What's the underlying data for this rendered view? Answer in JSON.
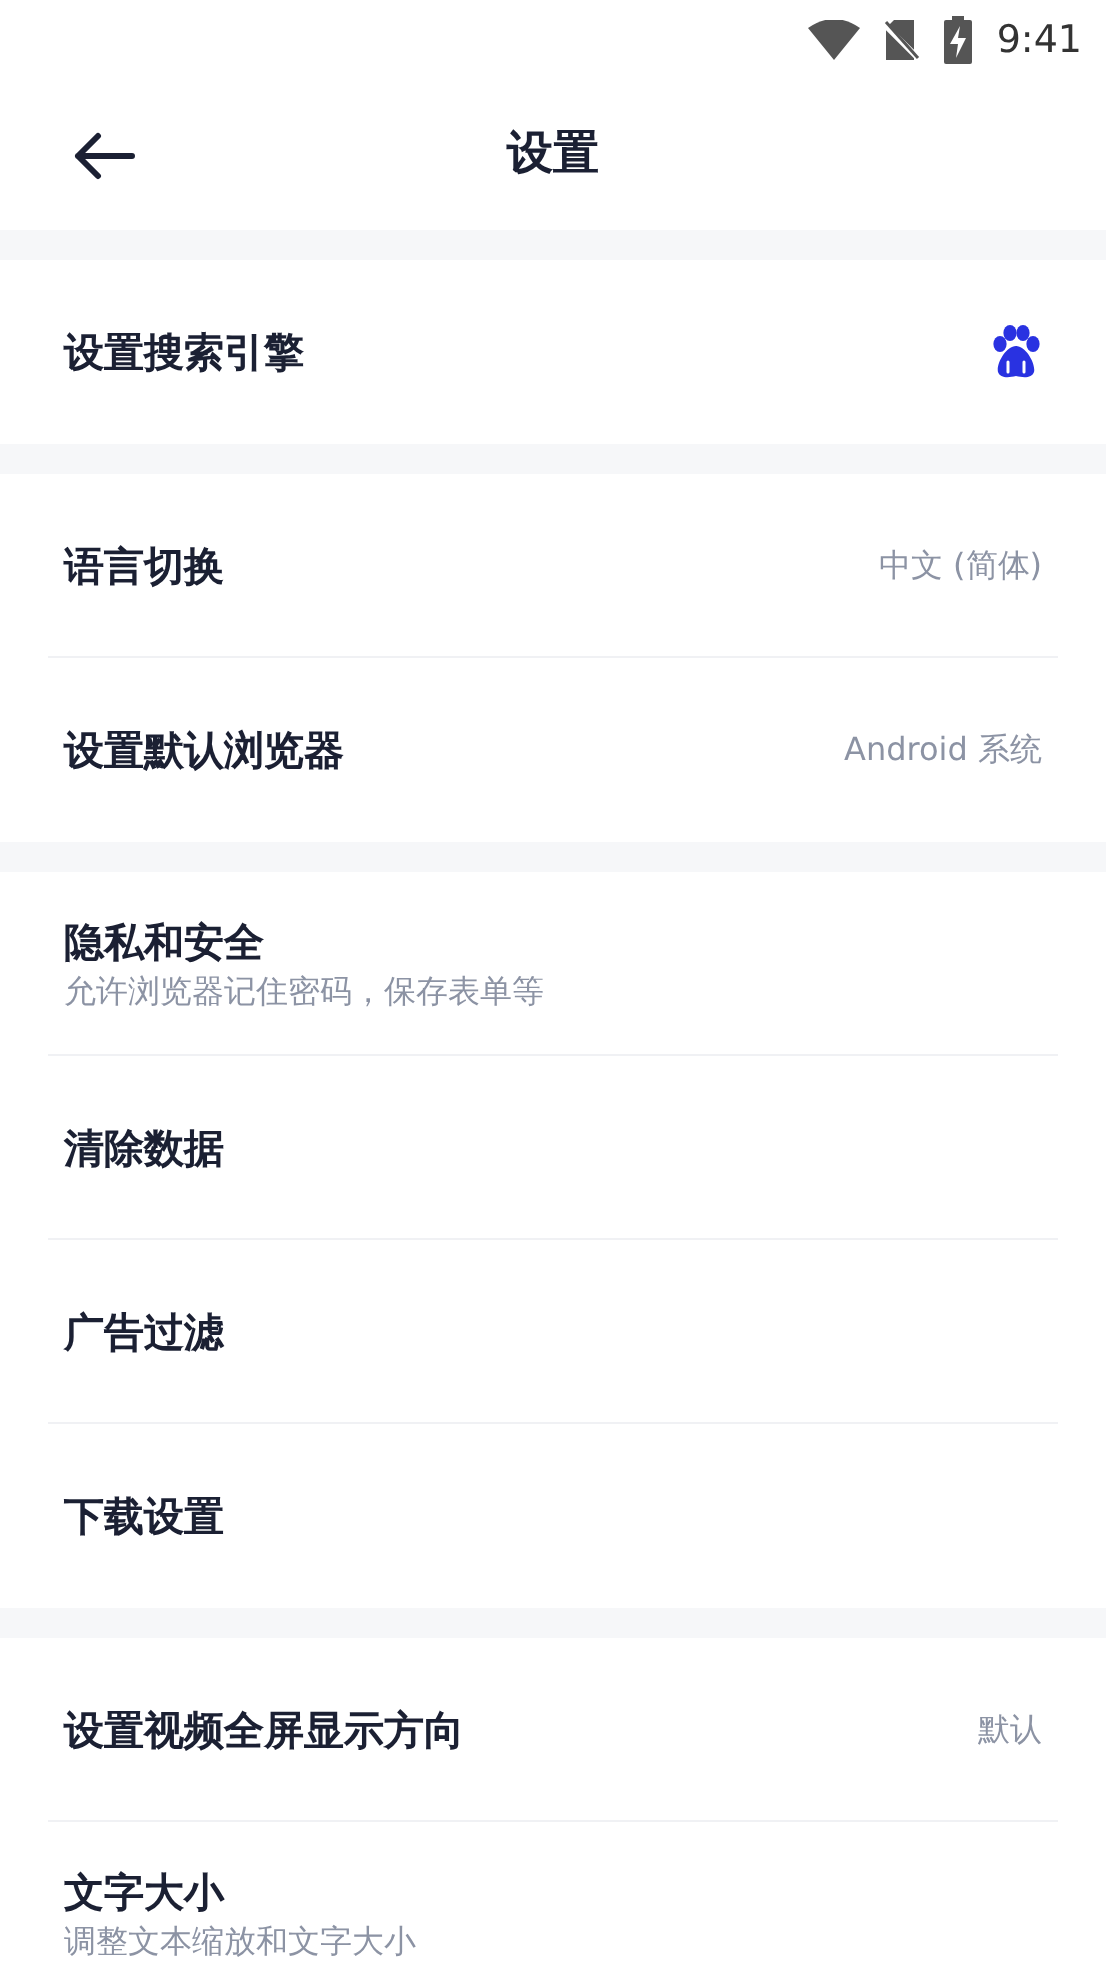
{
  "status_bar": {
    "time": "9:41"
  },
  "header": {
    "title": "设置"
  },
  "sections": [
    [
      {
        "title": "设置搜索引擎",
        "kind": "engine"
      }
    ],
    [
      {
        "title": "语言切换",
        "kind": "value",
        "value": "中文 (简体)"
      },
      {
        "title": "设置默认浏览器",
        "kind": "value",
        "value": "Android 系统"
      }
    ],
    [
      {
        "title": "隐私和安全",
        "kind": "subtitle",
        "subtitle": "允许浏览器记住密码，保存表单等"
      },
      {
        "title": "清除数据",
        "kind": "plain"
      },
      {
        "title": "广告过滤",
        "kind": "plain"
      },
      {
        "title": "下载设置",
        "kind": "plain"
      }
    ],
    [
      {
        "title": "设置视频全屏显示方向",
        "kind": "value",
        "value": "默认"
      },
      {
        "title": "文字大小",
        "kind": "subtitle",
        "subtitle": "调整文本缩放和文字大小"
      }
    ]
  ]
}
